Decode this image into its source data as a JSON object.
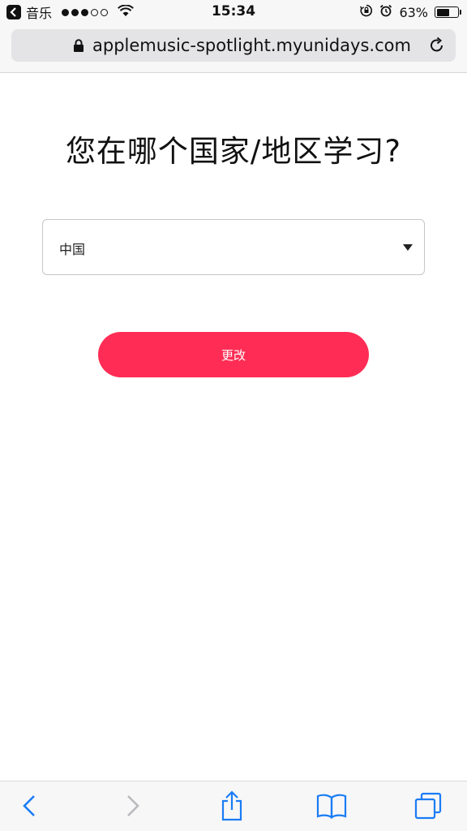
{
  "status_bar": {
    "back_app": "音乐",
    "time": "15:34",
    "battery": "63%",
    "battery_level": 0.63,
    "signal_bars_filled": 3,
    "signal_bars_total": 5
  },
  "browser": {
    "url": "applemusic-spotlight.myunidays.com"
  },
  "page": {
    "heading": "您在哪个国家/地区学习?",
    "country_select": {
      "selected": "中国"
    },
    "submit_label": "更改"
  },
  "colors": {
    "accent": "#ff2d55",
    "toolbar_icon": "#1a7cf5",
    "toolbar_disabled": "#b9b9be"
  },
  "icons": {
    "status": [
      "back-arrow-icon",
      "wifi-icon",
      "orientation-lock-icon",
      "alarm-icon",
      "battery-icon"
    ],
    "toolbar": [
      "back-icon",
      "forward-icon",
      "share-icon",
      "bookmarks-icon",
      "tabs-icon"
    ]
  }
}
